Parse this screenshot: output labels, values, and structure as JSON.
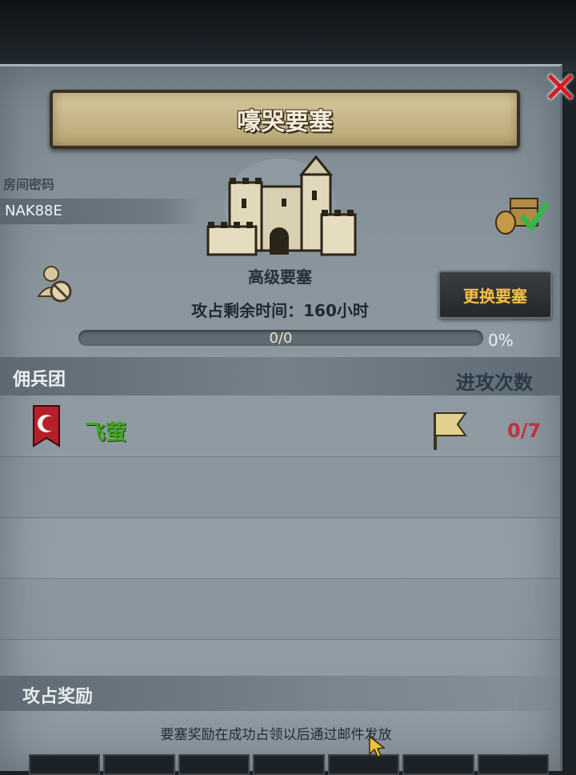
{
  "title": "嚎哭要塞",
  "room": {
    "label": "房间密码",
    "code": "NAK88E"
  },
  "fortress": {
    "grade": "高级要塞",
    "change_button": "更换要塞",
    "time_left": "攻占剩余时间：160小时",
    "progress_text": "0/0",
    "progress_percent_text": "0%",
    "progress_fraction": 0
  },
  "mercenary": {
    "section_label": "佣兵团",
    "attack_count_label": "进攻次数",
    "rows": [
      {
        "name": "飞萤",
        "attacks": "0/7"
      }
    ]
  },
  "reward": {
    "section_label": "攻占奖励",
    "note": "要塞奖励在成功占领以后通过邮件发放"
  },
  "colors": {
    "guild_name": "#3ea91c",
    "attack_count": "#c0303e",
    "button_text": "#f1c04f",
    "close": "#d11e23"
  },
  "icons": {
    "close": "close-icon",
    "castle": "castle-icon",
    "user_blocked": "user-blocked-icon",
    "reward_claimed": "reward-claimed-icon",
    "guild_emblem": "crescent-banner-icon",
    "flag": "flag-icon"
  }
}
